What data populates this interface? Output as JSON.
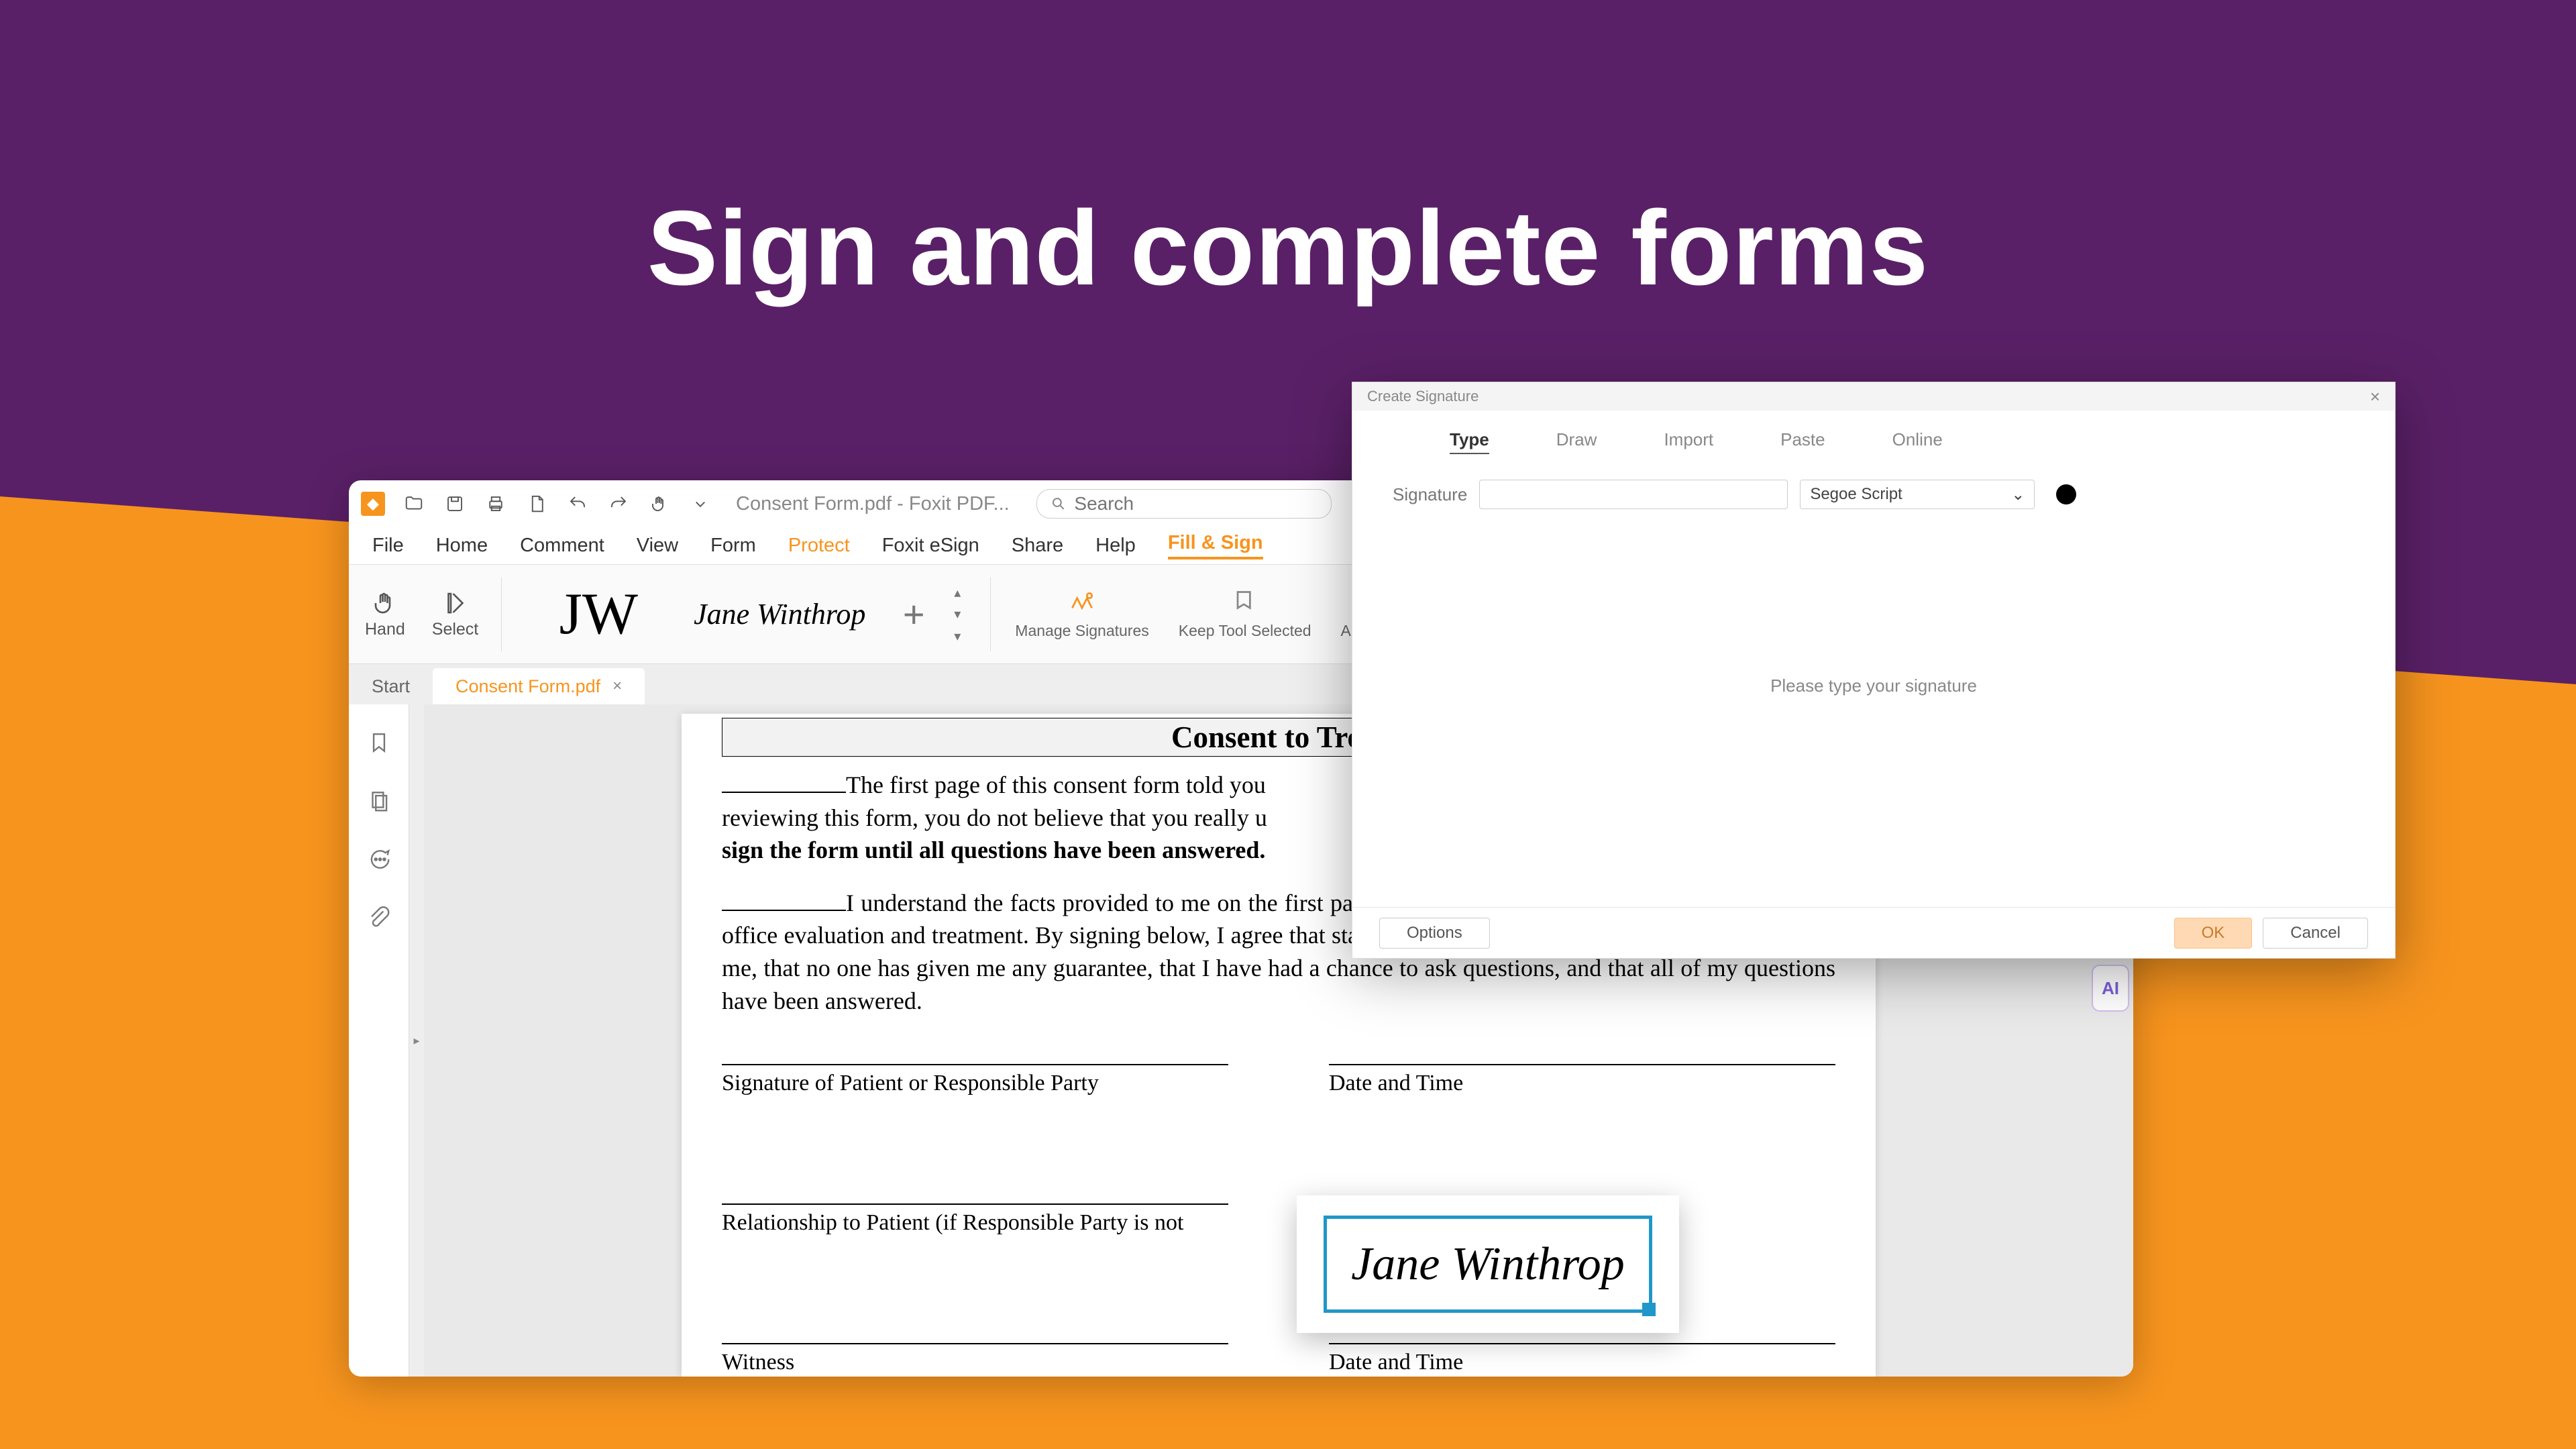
{
  "headline": "Sign and complete forms",
  "window_title_doc": "Consent Form.pdf - Foxit PDF...",
  "search_placeholder": "Search",
  "menus": {
    "file": "File",
    "home": "Home",
    "comment": "Comment",
    "view": "View",
    "form": "Form",
    "protect": "Protect",
    "esign": "Foxit eSign",
    "share": "Share",
    "help": "Help",
    "fillsign": "Fill & Sign"
  },
  "ribbon": {
    "hand": "Hand",
    "select": "Select",
    "sig_initials": "JW",
    "sig_full": "Jane Winthrop",
    "manage": "Manage Signatures",
    "keep": "Keep Tool Selected",
    "applyall": "Apply All Signatures"
  },
  "tabs": {
    "start": "Start",
    "active": "Consent Form.pdf",
    "close_x": "×"
  },
  "document": {
    "heading": "Consent to Treat",
    "para1a": "The first page of this consent form told you",
    "para1b": "reviewing this form, you do not believe that you really u",
    "para1c": "sign the form until all questions have been answered.",
    "para2": "I understand the facts provided to me on the first page of this consent form. I give my consent for in-office evaluation and treatment. By signing below, I agree that staff/doctor has discussed the facts in this form with me, that no one has given me any guarantee, that I have had a chance to ask questions, and that all of my questions have been answered.",
    "sig_patient": "Signature of Patient or Responsible Party",
    "date_time": "Date and Time",
    "relationship": "Relationship to Patient (if Responsible Party is not",
    "witness": "Witness"
  },
  "floating_signature": "Jane Winthrop",
  "right_rail": {
    "ai": "AI"
  },
  "dialog": {
    "title": "Create Signature",
    "tabs": {
      "type": "Type",
      "draw": "Draw",
      "import": "Import",
      "paste": "Paste",
      "online": "Online"
    },
    "sig_label": "Signature",
    "font": "Segoe Script",
    "hint": "Please type your signature",
    "options": "Options",
    "ok": "OK",
    "cancel": "Cancel",
    "close_x": "×"
  }
}
